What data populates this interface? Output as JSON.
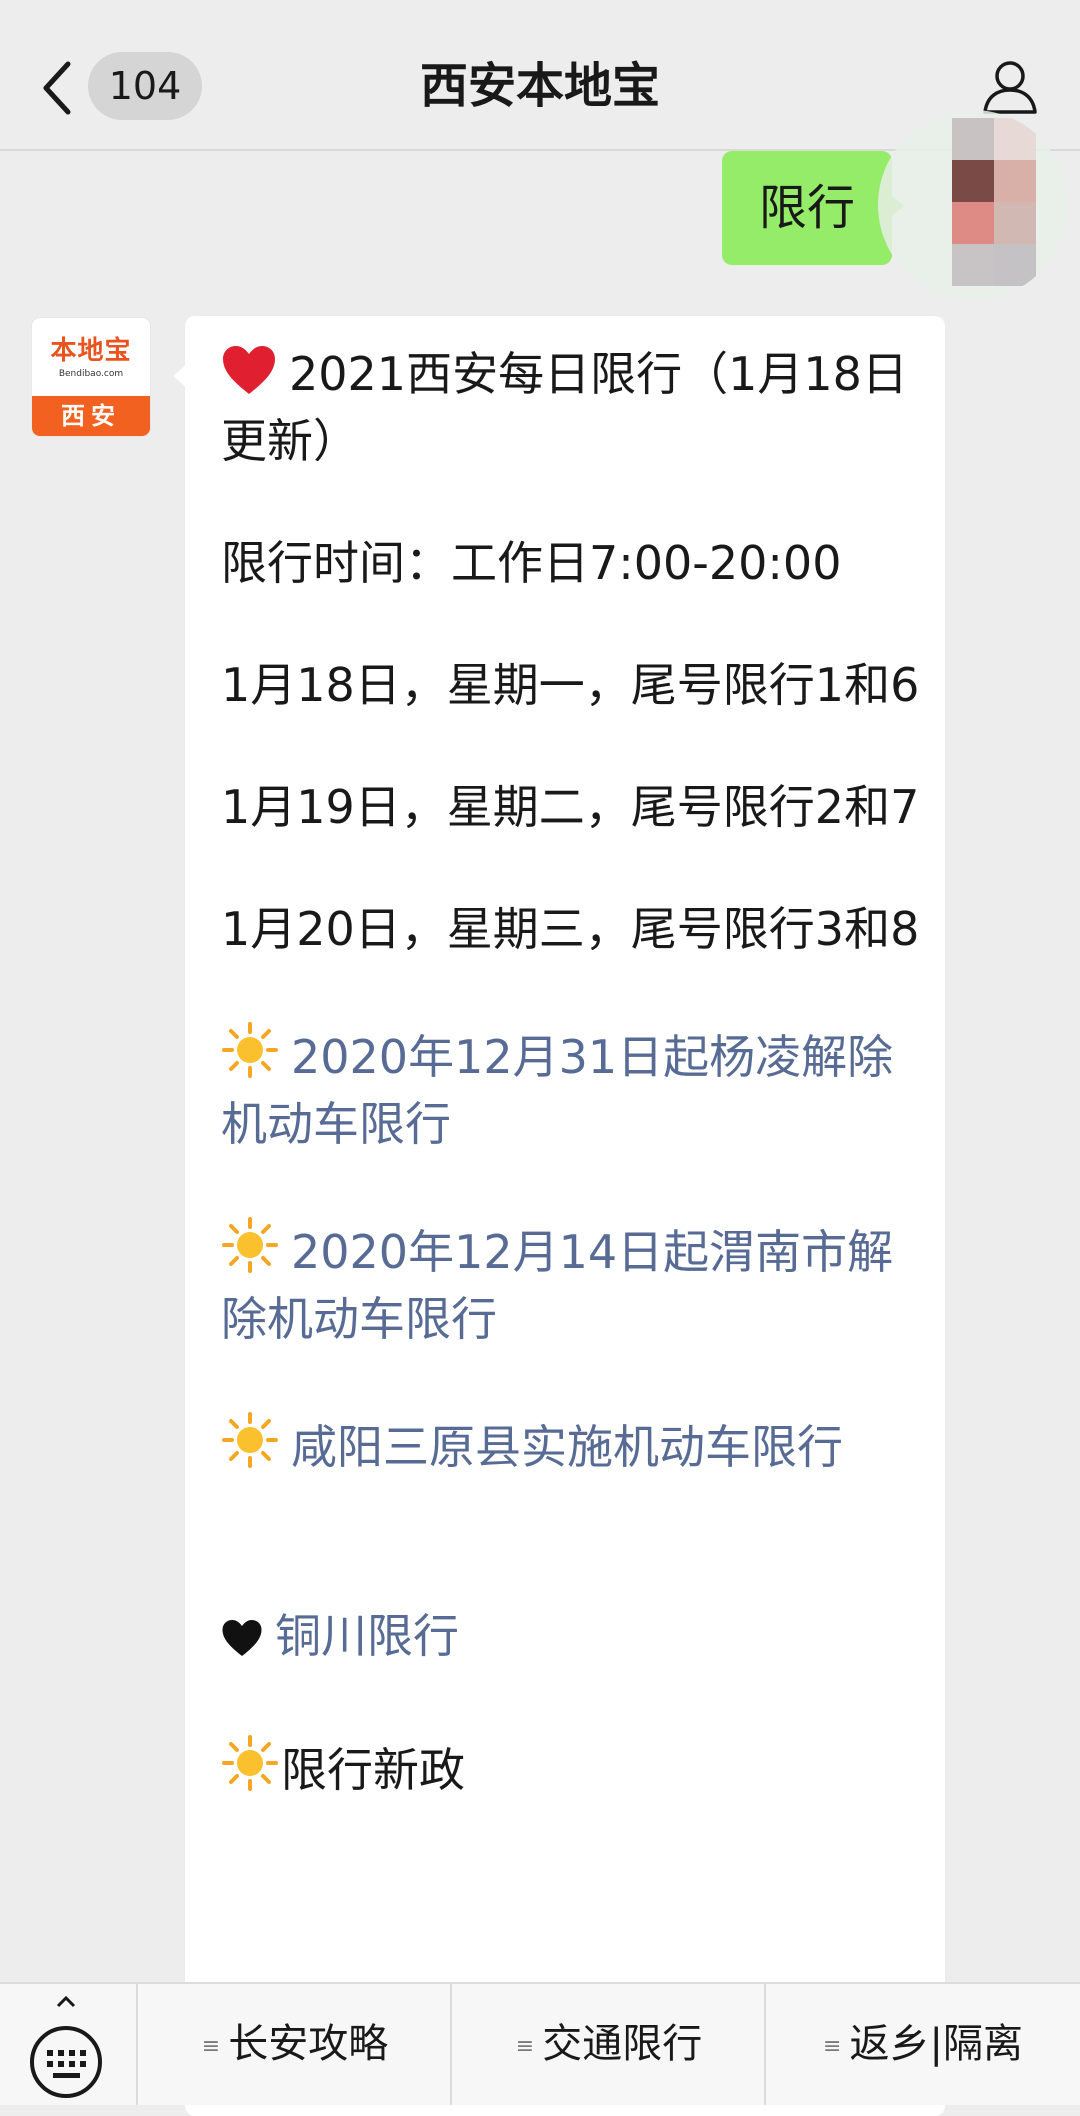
{
  "header": {
    "unread_count": "104",
    "title": "西安本地宝",
    "back_icon": "chevron-left-icon",
    "profile_icon": "person-icon"
  },
  "outgoing": {
    "text": "限行"
  },
  "incoming": {
    "avatar_logo_cn": "本地宝",
    "avatar_logo_en": "Bendibao.com",
    "avatar_city": "西安",
    "lines": {
      "headline": "2021西安每日限行（1月18日更新）",
      "time": "限行时间：工作日7:00-20:00",
      "day1": "1月18日，星期一，尾号限行1和6",
      "day2": "1月19日，星期二，尾号限行2和7",
      "day3": "1月20日，星期三，尾号限行3和8",
      "link1": "2020年12月31日起杨凌解除机动车限行",
      "link2": "2020年12月14日起渭南市解除机动车限行",
      "link3": "咸阳三原县实施机动车限行",
      "link4": "铜川限行",
      "last": "限行新政"
    }
  },
  "bottom_menu": {
    "keyboard_icon": "keyboard-icon",
    "items": [
      {
        "label": "长安攻略"
      },
      {
        "label": "交通限行"
      },
      {
        "label": "返乡|隔离"
      }
    ]
  },
  "colors": {
    "chat_bg": "#ededed",
    "outgoing_bubble": "#95ec69",
    "link": "#576b95",
    "brand_orange": "#f2611f"
  }
}
